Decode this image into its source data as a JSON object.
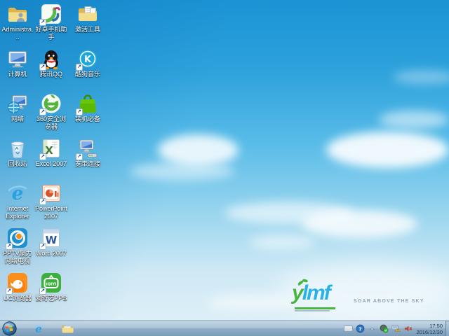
{
  "desktop": {
    "icons": [
      {
        "label": "Administra...",
        "icon": "administrator-folder",
        "shortcut": false
      },
      {
        "label": "计算机",
        "icon": "computer",
        "shortcut": false
      },
      {
        "label": "网络",
        "icon": "network",
        "shortcut": false
      },
      {
        "label": "回收站",
        "icon": "recycle-bin",
        "shortcut": false
      },
      {
        "label": "Internet Explorer",
        "icon": "internet-explorer",
        "shortcut": false
      },
      {
        "label": "PPTV聚力 网络电视",
        "icon": "pptv",
        "shortcut": true
      },
      {
        "label": "UC浏览器",
        "icon": "uc-browser",
        "shortcut": true
      },
      {
        "label": "好卓手机助手",
        "icon": "haozhuo-phone-assistant",
        "shortcut": true
      },
      {
        "label": "腾讯QQ",
        "icon": "tencent-qq",
        "shortcut": true
      },
      {
        "label": "360安全浏览器",
        "icon": "360-secure-browser",
        "shortcut": true
      },
      {
        "label": "Excel 2007",
        "icon": "excel-2007",
        "shortcut": true
      },
      {
        "label": "PowerPoint 2007",
        "icon": "powerpoint-2007",
        "shortcut": true
      },
      {
        "label": "Word 2007",
        "icon": "word-2007",
        "shortcut": true
      },
      {
        "label": "爱奇艺PPS",
        "icon": "iqiyi-pps",
        "shortcut": true
      },
      {
        "label": "激活工具",
        "icon": "activation-tools-folder",
        "shortcut": false
      },
      {
        "label": "酷狗音乐",
        "icon": "kugou-music",
        "shortcut": true
      },
      {
        "label": "装机必备",
        "icon": "essential-software-bag",
        "shortcut": true
      },
      {
        "label": "宽带连接",
        "icon": "broadband-connection",
        "shortcut": true
      }
    ],
    "wallpaper": {
      "brand_y": "y",
      "brand_rest": "lmf",
      "tagline": "SOAR ABOVE THE SKY"
    }
  },
  "taskbar": {
    "pinned": [
      "start-button",
      "internet-explorer",
      "windows-explorer"
    ],
    "tray_icons": [
      "language-indicator",
      "help",
      "show-hidden-icons",
      "security-check",
      "network-warning",
      "volume-muted"
    ],
    "clock": {
      "time": "17:50",
      "date": "2016/12/30"
    }
  },
  "colors": {
    "sky_top": "#1b93d4",
    "sky_bottom": "#ddeff7",
    "taskbar": "#90aec7",
    "brand_green": "#49b53e",
    "brand_blue": "#29b2e5"
  }
}
